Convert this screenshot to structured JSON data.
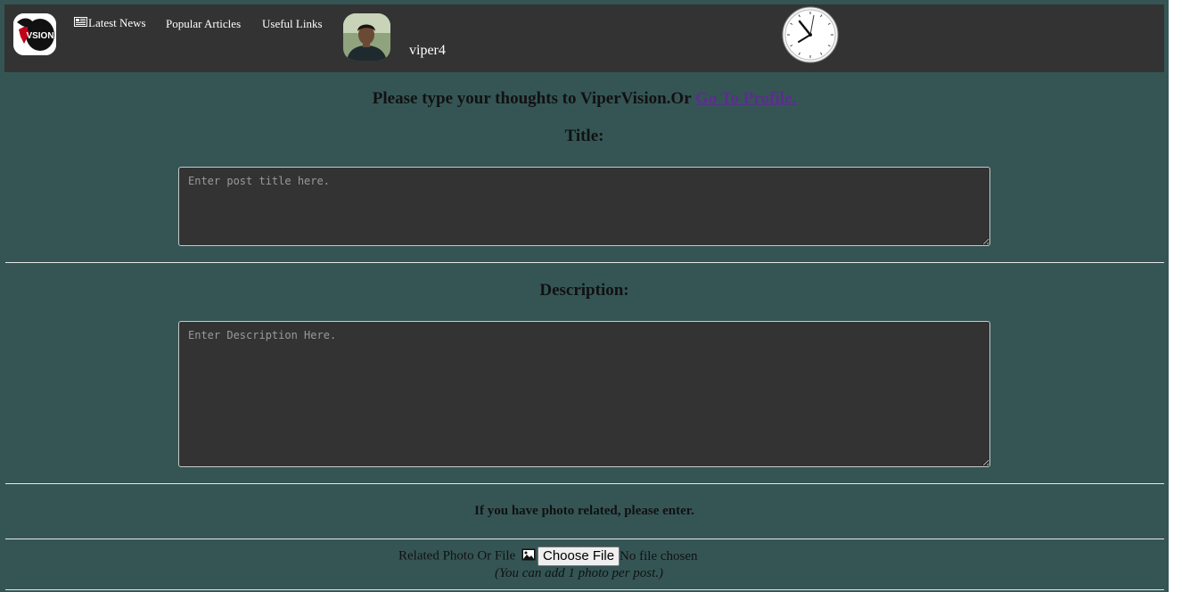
{
  "nav": {
    "latest_news": "Latest News",
    "popular_articles": "Popular Articles",
    "useful_links": "Useful Links",
    "username": "viper4",
    "icons": {
      "logo": "viper-vision-logo",
      "news": "newspaper-icon",
      "avatar": "user-avatar",
      "clock": "analog-clock",
      "photo": "photo-icon"
    }
  },
  "intro": {
    "text": "Please type your thoughts to ViperVision.Or ",
    "link": "Go To Profile."
  },
  "title_section": {
    "label": "Title:",
    "placeholder": "Enter post title here."
  },
  "description_section": {
    "label": "Description:",
    "placeholder": "Enter Description Here."
  },
  "photo_section": {
    "prompt": "If you have photo related, please enter.",
    "label": "Related Photo Or File",
    "button": "Choose File",
    "status": "No file chosen",
    "note": "(You can add 1 photo per post.)"
  },
  "colors": {
    "page_background": "#355555",
    "nav_background": "#333333",
    "textarea_background": "#333333",
    "link": "#5b2d8e"
  }
}
